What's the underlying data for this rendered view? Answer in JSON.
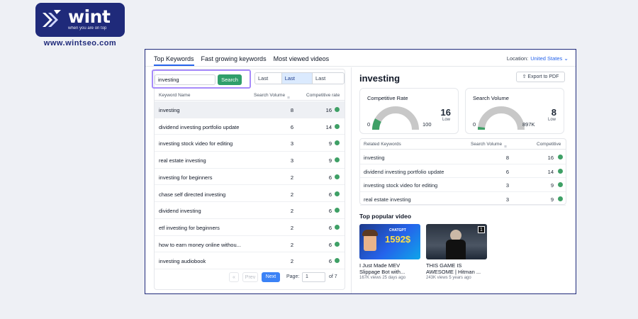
{
  "brand": {
    "name": "wint",
    "tagline": "when you are on top",
    "url": "www.wintseo.com"
  },
  "tabs": [
    {
      "label": "Top Keywords",
      "active": true
    },
    {
      "label": "Fast growing keywords",
      "active": false
    },
    {
      "label": "Most viewed videos",
      "active": false
    }
  ],
  "location": {
    "label": "Location:",
    "value": "United States"
  },
  "search": {
    "value": "investing",
    "button": "Search"
  },
  "ranges": [
    {
      "label": "Last Day",
      "selected": false
    },
    {
      "label": "Last Week",
      "selected": true
    },
    {
      "label": "Last Month",
      "selected": false
    }
  ],
  "table": {
    "headers": {
      "keyword": "Keyword Name",
      "volume": "Search Volume",
      "rate": "Competitive rate"
    },
    "rows": [
      {
        "keyword": "investing",
        "volume": "8",
        "rate": "16"
      },
      {
        "keyword": "dividend investing portfolio update",
        "volume": "6",
        "rate": "14"
      },
      {
        "keyword": "investing stock video for editing",
        "volume": "3",
        "rate": "9"
      },
      {
        "keyword": "real estate investing",
        "volume": "3",
        "rate": "9"
      },
      {
        "keyword": "investing for beginners",
        "volume": "2",
        "rate": "6"
      },
      {
        "keyword": "chase self directed investing",
        "volume": "2",
        "rate": "6"
      },
      {
        "keyword": "dividend investing",
        "volume": "2",
        "rate": "6"
      },
      {
        "keyword": "etf investing for beginners",
        "volume": "2",
        "rate": "6"
      },
      {
        "keyword": "how to earn money online withou...",
        "volume": "2",
        "rate": "6"
      },
      {
        "keyword": "investing audiobook",
        "volume": "2",
        "rate": "6"
      }
    ]
  },
  "pagination": {
    "first": "«",
    "prev": "Prev",
    "next": "Next",
    "page_label": "Page:",
    "page": "1",
    "of": "of 7"
  },
  "detail": {
    "title": "investing",
    "export": "Export to PDF",
    "competitive": {
      "title": "Competitive Rate",
      "min": "0",
      "max": "100",
      "value": "16",
      "level": "Low",
      "fraction": 0.16
    },
    "volume": {
      "title": "Search Volume",
      "min": "0",
      "max": "897K",
      "value": "8",
      "level": "Low",
      "fraction": 0.04
    }
  },
  "related": {
    "headers": {
      "keyword": "Related Keywords",
      "volume": "Search Volume",
      "rate": "Competitive"
    },
    "rows": [
      {
        "keyword": "investing",
        "volume": "8",
        "rate": "16"
      },
      {
        "keyword": "dividend investing portfolio update",
        "volume": "6",
        "rate": "14"
      },
      {
        "keyword": "investing stock video for editing",
        "volume": "3",
        "rate": "9"
      },
      {
        "keyword": "real estate investing",
        "volume": "3",
        "rate": "9"
      }
    ]
  },
  "videos": {
    "title": "Top popular video",
    "items": [
      {
        "title_line1": "I Just Made MEV",
        "title_line2": "Slippage Bot with...",
        "meta": "167K views 25 days ago",
        "thumb_text1": "CHATGPT",
        "thumb_text2": "1592$"
      },
      {
        "title_line1": "THIS GAME IS",
        "title_line2": "AWESOME | Hitman ...",
        "meta": "243K views 5 years ago",
        "thumb_text1": "1"
      }
    ]
  },
  "colors": {
    "accent": "#2563eb",
    "brand": "#1f2a7a",
    "green": "#2f9e6b",
    "dot": "#3fa066",
    "gauge": "#c8c8c8",
    "gauge_fill": "#3fa066"
  }
}
